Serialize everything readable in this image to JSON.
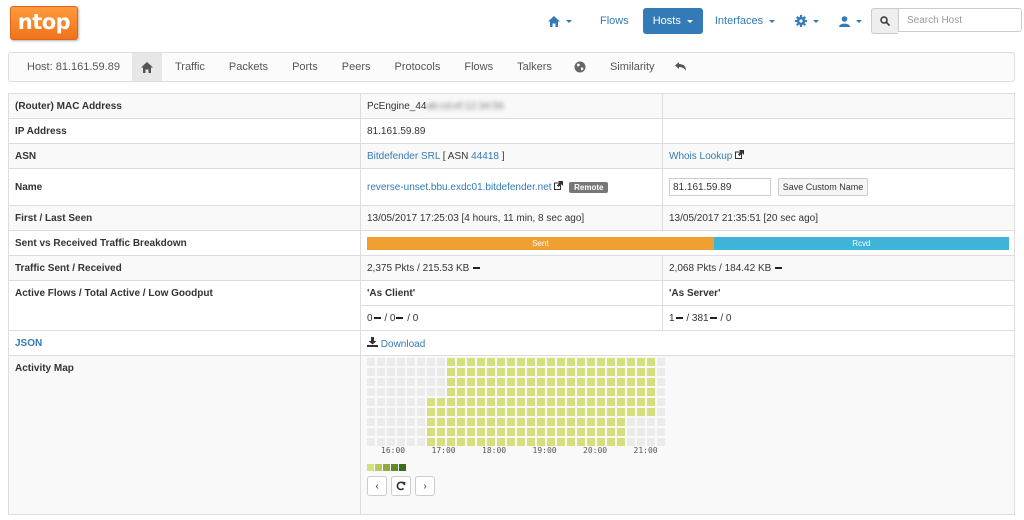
{
  "brand": "ntop",
  "nav": {
    "flows": "Flows",
    "hosts": "Hosts",
    "interfaces": "Interfaces",
    "search_placeholder": "Search Host"
  },
  "tabs": {
    "host": "Host: 81.161.59.89",
    "traffic": "Traffic",
    "packets": "Packets",
    "ports": "Ports",
    "peers": "Peers",
    "protocols": "Protocols",
    "flows": "Flows",
    "talkers": "Talkers",
    "similarity": "Similarity"
  },
  "info": {
    "mac_label": "(Router) MAC Address",
    "mac_value": "PcEngine_44",
    "mac_hidden": "ab:cd:ef:12:34:56",
    "ip_label": "IP Address",
    "ip_value": "81.161.59.89",
    "asn_label": "ASN",
    "asn_name": "Bitdefender SRL",
    "asn_prefix": "[ ASN",
    "asn_number": "44418",
    "asn_suffix": "]",
    "whois": "Whois Lookup",
    "name_label": "Name",
    "name_value": "reverse-unset.bbu.exdc01.bitdefender.net",
    "remote_badge": "Remote",
    "custom_name_value": "81.161.59.89",
    "save_button": "Save Custom Name",
    "seen_label": "First / Last Seen",
    "first_seen": "13/05/2017 17:25:03 [4 hours, 11 min, 8 sec ago]",
    "last_seen": "13/05/2017 21:35:51 [20 sec ago]",
    "breakdown_label": "Sent vs Received Traffic Breakdown",
    "sent": "Sent",
    "rcvd": "Rcvd",
    "sent_fraction": 0.54,
    "traffic_label": "Traffic Sent / Received",
    "traffic_sent": "2,375 Pkts / 215.53 KB",
    "traffic_rcvd": "2,068 Pkts / 184.42 KB",
    "flows_label": "Active Flows / Total Active / Low Goodput",
    "as_client": "'As Client'",
    "as_server": "'As Server'",
    "client_a": "0",
    "client_b": "/ 0",
    "client_c": "/ 0",
    "server_a": "1",
    "server_b": "/ 381",
    "server_c": "/ 0",
    "json_label": "JSON",
    "download": "Download",
    "map_label": "Activity Map",
    "map_ticks": [
      "16:00",
      "17:00",
      "18:00",
      "19:00",
      "20:00",
      "21:00"
    ],
    "map_active_start_col": 6,
    "map_active_end_col": 28,
    "map_rows": 9,
    "map_cols": 30
  },
  "colors": {
    "primary": "#337ab7",
    "sent": "#f0a030",
    "rcvd": "#3db4d8",
    "map_active": "#d5e07c",
    "map_idle": "#ebebeb",
    "alert": "#d9383a"
  },
  "icons": [
    "home-icon",
    "gear-icon",
    "user-icon",
    "warning-icon",
    "search-icon",
    "globe-icon",
    "undo-icon",
    "external-link-icon",
    "download-icon",
    "chevron-left-icon",
    "refresh-icon",
    "chevron-right-icon"
  ]
}
